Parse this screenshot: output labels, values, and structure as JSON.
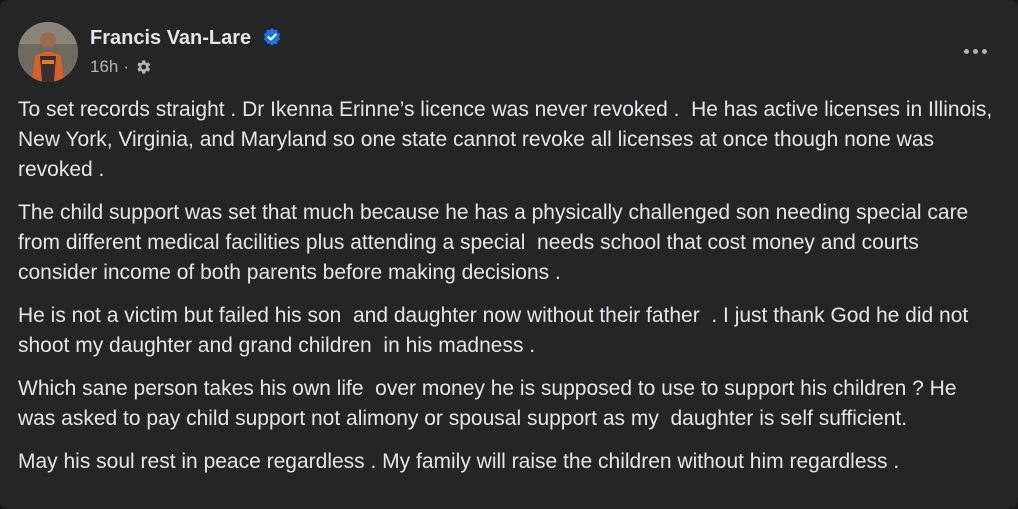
{
  "post": {
    "author": {
      "name": "Francis Van-Lare",
      "verified_icon": "verified-badge-icon",
      "avatar_icon": "profile-photo"
    },
    "meta": {
      "time": "16h",
      "separator": "·",
      "privacy_icon": "gear-icon"
    },
    "menu_icon": "more-options-icon",
    "paragraphs": [
      "To set records straight . Dr Ikenna Erinne’s licence was never revoked .  He has active licenses in Illinois, New York, Virginia, and Maryland so one state cannot revoke all licenses at once though none was revoked .",
      "The child support was set that much because he has a physically challenged son needing special care from different medical facilities plus attending a special  needs school that cost money and courts consider income of both parents before making decisions .",
      "He is not a victim but failed his son  and daughter now without their father  . I just thank God he did not shoot my daughter and grand children  in his madness .",
      "Which sane person takes his own life  over money he is supposed to use to support his children ? He was asked to pay child support not alimony or spousal support as my  daughter is self sufficient.",
      "May his soul rest in peace regardless . My family will raise the children without him regardless ."
    ]
  },
  "colors": {
    "background": "#242526",
    "text_primary": "#e4e6eb",
    "text_secondary": "#b0b3b8",
    "verified_blue": "#1b74e4"
  }
}
